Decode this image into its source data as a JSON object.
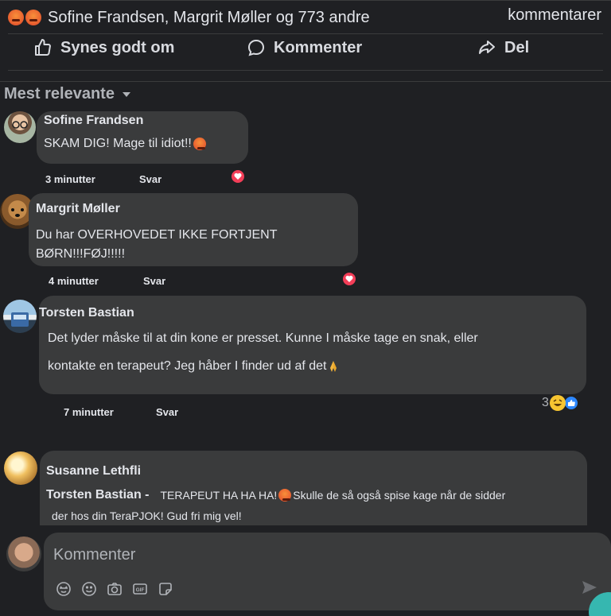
{
  "reactions": {
    "summary": "Sofine Frandsen, Margrit Møller og 773 andre",
    "comments_label": "kommentarer"
  },
  "actions": {
    "like": "Synes godt om",
    "comment": "Kommenter",
    "share": "Del"
  },
  "sort": {
    "label": "Mest relevante"
  },
  "comments": [
    {
      "author": "Sofine Frandsen",
      "text": "SKAM DIG! Mage til idiot!!",
      "time": "3 minutter",
      "reply": "Svar"
    },
    {
      "author": "Margrit Møller",
      "text_line1": "Du har OVERHOVEDET IKKE FORTJENT",
      "text_line2": "BØRN!!!FØJ!!!!!",
      "time": "4 minutter",
      "reply": "Svar"
    },
    {
      "author": "Torsten Bastian",
      "text_line1": "Det lyder måske til at din kone er presset. Kunne I måske tage en snak, eller",
      "text_line2": "kontakte en terapeut? Jeg håber I finder ud af det",
      "time": "7 minutter",
      "reply": "Svar",
      "reaction_count": "3"
    },
    {
      "author": "Susanne Lethfli",
      "mention": "Torsten Bastian -",
      "text_line1": "TERAPEUT HA HA HA!",
      "text_line1b": "Skulle de så også spise kage når de sidder",
      "text_line2": "der hos din TeraPJOK! Gud fri mig vel!"
    }
  ],
  "composer": {
    "placeholder": "Kommenter"
  },
  "colors": {
    "background": "#1f2023",
    "bubble": "#3a3b3c",
    "heart": "#f33e58",
    "like_blue": "#2d88ff"
  },
  "icons": [
    "angry-emoji-icon",
    "thumbs-up-icon",
    "comment-bubble-icon",
    "share-arrow-icon",
    "caret-down-icon",
    "heart-reaction-icon",
    "laugh-reaction-icon",
    "like-reaction-icon",
    "prayer-hands-emoji-icon",
    "avatar-sticker-icon",
    "smiley-icon",
    "camera-icon",
    "gif-icon",
    "sticker-icon",
    "send-icon"
  ]
}
